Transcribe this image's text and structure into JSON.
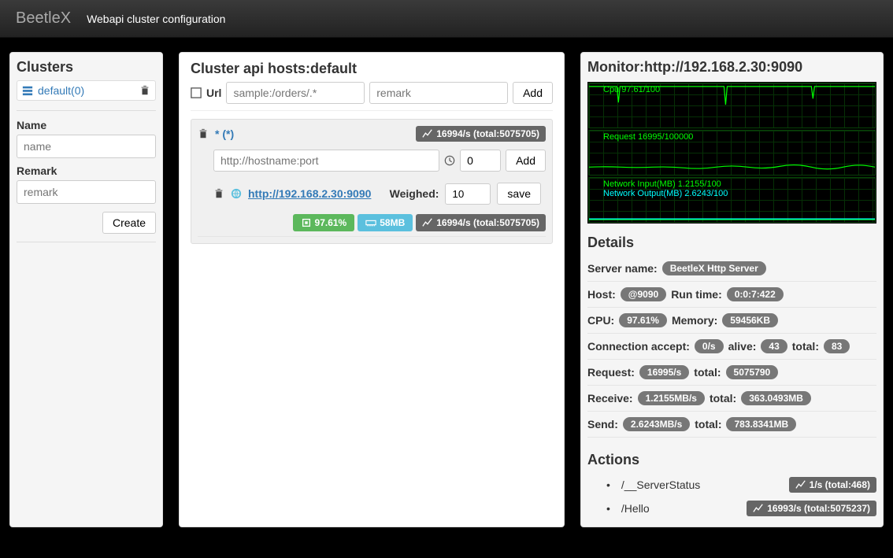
{
  "navbar": {
    "brand": "BeetleX",
    "subtitle": "Webapi cluster configuration"
  },
  "clusters": {
    "title": "Clusters",
    "item_label": "default(0)",
    "name_label": "Name",
    "name_placeholder": "name",
    "remark_label": "Remark",
    "remark_placeholder": "remark",
    "create_btn": "Create"
  },
  "hosts": {
    "title_prefix": "Cluster api hosts:",
    "title_value": "default",
    "url_label": "Url",
    "url_placeholder": "sample:/orders/.*",
    "remark_placeholder": "remark",
    "add_btn": "Add",
    "route": {
      "pattern": "* (*)",
      "rate_badge": "16994/s (total:5075705)",
      "host_placeholder": "http://hostname:port",
      "weight_value": "0",
      "add_btn": "Add",
      "server_url": "http://192.168.2.30:9090",
      "weighed_label": "Weighed:",
      "weighed_value": "10",
      "save_btn": "save",
      "cpu_badge": "97.61%",
      "mem_badge": "58MB",
      "rate_badge2": "16994/s (total:5075705)"
    }
  },
  "monitor": {
    "title_prefix": "Monitor:",
    "title_value": "http://192.168.2.30:9090",
    "charts": {
      "cpu_label": "Cpu 97.61/100",
      "req_label": "Request 16995/100000",
      "net_in_label": "Network Input(MB) 1.2155/100",
      "net_out_label": "Network Output(MB) 2.6243/100"
    },
    "details_title": "Details",
    "details": {
      "server_name_k": "Server name:",
      "server_name_v": "BeetleX Http Server",
      "host_k": "Host:",
      "host_v": "@9090",
      "runtime_k": "Run time:",
      "runtime_v": "0:0:7:422",
      "cpu_k": "CPU:",
      "cpu_v": "97.61%",
      "mem_k": "Memory:",
      "mem_v": "59456KB",
      "conn_accept_k": "Connection accept:",
      "conn_accept_v": "0/s",
      "alive_k": "alive:",
      "alive_v": "43",
      "total_k": "total:",
      "conn_total_v": "83",
      "req_k": "Request:",
      "req_v": "16995/s",
      "req_total_v": "5075790",
      "recv_k": "Receive:",
      "recv_v": "1.2155MB/s",
      "recv_total_v": "363.0493MB",
      "send_k": "Send:",
      "send_v": "2.6243MB/s",
      "send_total_v": "783.8341MB"
    },
    "actions_title": "Actions",
    "actions": [
      {
        "path": "/__ServerStatus",
        "badge": "1/s (total:468)"
      },
      {
        "path": "/Hello",
        "badge": "16993/s (total:5075237)"
      }
    ]
  },
  "chart_data": [
    {
      "type": "line",
      "title": "Cpu",
      "ylim": [
        0,
        100
      ],
      "value": 97.61,
      "series": [
        {
          "name": "Cpu",
          "values": [
            98,
            98,
            97,
            60,
            98,
            98,
            98,
            98,
            97,
            98,
            98,
            55,
            98,
            98,
            98,
            97,
            98,
            98,
            98,
            70,
            98
          ]
        }
      ]
    },
    {
      "type": "line",
      "title": "Request",
      "ylim": [
        0,
        100000
      ],
      "value": 16995,
      "series": [
        {
          "name": "Request",
          "values": [
            17000,
            17000,
            16900,
            17100,
            17000,
            16800,
            17200,
            17000,
            17000,
            16900,
            17000,
            17100,
            17000,
            17000,
            17000,
            17000,
            17000,
            17000,
            17000,
            17000,
            17000
          ]
        }
      ]
    },
    {
      "type": "line",
      "title": "Network",
      "ylim": [
        0,
        100
      ],
      "series": [
        {
          "name": "Input(MB)",
          "value": 1.2155,
          "values": [
            1.2,
            1.2,
            1.2,
            1.2,
            1.2,
            1.2,
            1.2,
            1.2,
            1.2,
            1.2,
            1.2,
            1.2,
            1.2,
            1.2,
            1.2,
            1.2,
            1.2,
            1.2,
            1.2,
            1.2,
            1.2
          ]
        },
        {
          "name": "Output(MB)",
          "value": 2.6243,
          "values": [
            2.6,
            2.6,
            2.6,
            2.6,
            2.6,
            2.6,
            2.6,
            2.6,
            2.6,
            2.6,
            2.6,
            2.6,
            2.6,
            2.6,
            2.6,
            2.6,
            2.6,
            2.6,
            2.6,
            2.6,
            2.6
          ]
        }
      ]
    }
  ]
}
